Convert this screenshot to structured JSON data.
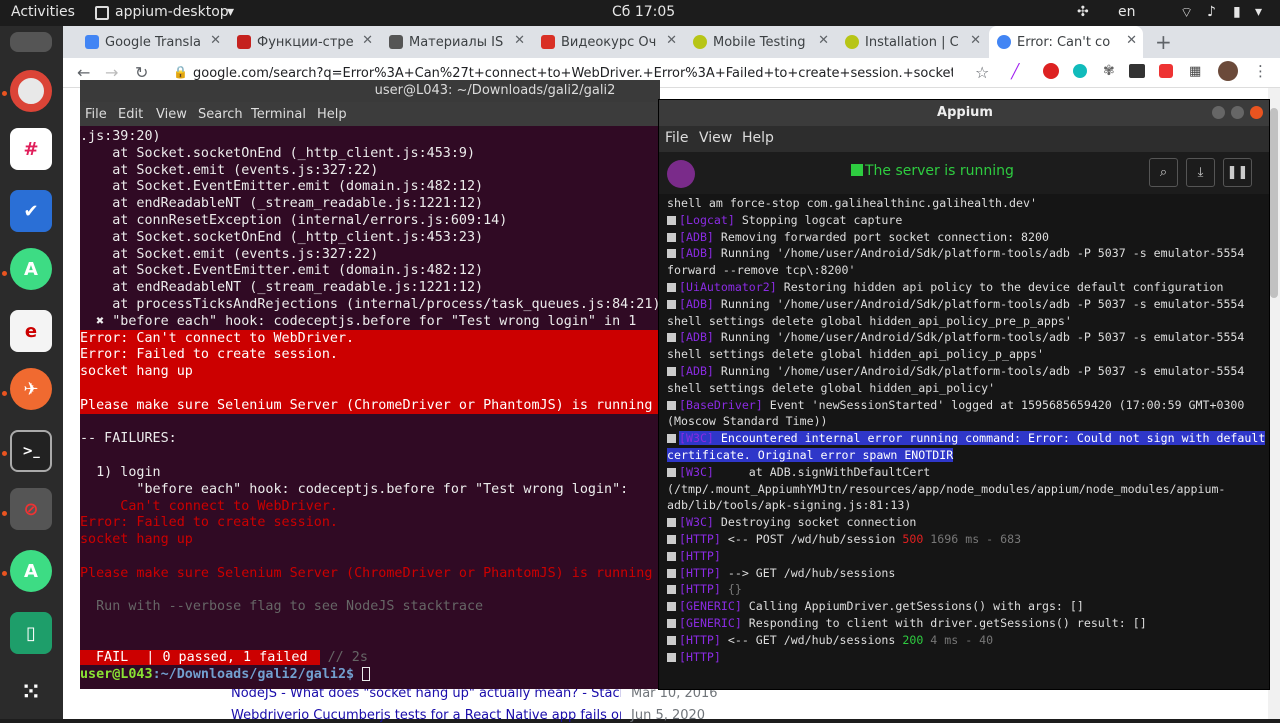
{
  "topbar": {
    "activities": "Activities",
    "app_name": "appium-desktop",
    "clock": "Сб 17:05",
    "lang": "en"
  },
  "browser": {
    "tabs": [
      {
        "title": "Google Transla",
        "color": "#4285f4"
      },
      {
        "title": "Функции-стре",
        "color": "#c5221f"
      },
      {
        "title": "Материалы IS",
        "color": "#555555"
      },
      {
        "title": "Видеокурс Оч",
        "color": "#d93025"
      },
      {
        "title": "Mobile Testing",
        "color": "#b7c516"
      },
      {
        "title": "Installation | C",
        "color": "#b7c516"
      },
      {
        "title": "Error: Can't co",
        "color": "#4285f4"
      }
    ],
    "url": "google.com/search?q=Error%3A+Can%27t+connect+to+WebDriver.+Error%3A+Failed+to+create+session.+socket+hang+up&o...",
    "results": [
      {
        "title": "NodeJS - What does \"socket hang up\" actually mean? - Stack ...",
        "date": "Mar 10, 2016"
      },
      {
        "title": "Webdriverio Cucumberjs tests for a React Native app fails on ...",
        "date": "Jun 5, 2020"
      }
    ]
  },
  "terminal": {
    "title": "user@L043: ~/Downloads/gali2/gali2",
    "menu": [
      "File",
      "Edit",
      "View",
      "Search",
      "Terminal",
      "Help"
    ],
    "lines": [
      {
        "t": ".js:39:20)",
        "c": ""
      },
      {
        "t": "    at Socket.socketOnEnd (_http_client.js:453:9)",
        "c": ""
      },
      {
        "t": "    at Socket.emit (events.js:327:22)",
        "c": ""
      },
      {
        "t": "    at Socket.EventEmitter.emit (domain.js:482:12)",
        "c": ""
      },
      {
        "t": "    at endReadableNT (_stream_readable.js:1221:12)",
        "c": ""
      },
      {
        "t": "    at connResetException (internal/errors.js:609:14)",
        "c": ""
      },
      {
        "t": "    at Socket.socketOnEnd (_http_client.js:453:23)",
        "c": ""
      },
      {
        "t": "    at Socket.emit (events.js:327:22)",
        "c": ""
      },
      {
        "t": "    at Socket.EventEmitter.emit (domain.js:482:12)",
        "c": ""
      },
      {
        "t": "    at endReadableNT (_stream_readable.js:1221:12)",
        "c": ""
      },
      {
        "t": "    at processTicksAndRejections (internal/process/task_queues.js:84:21)",
        "c": ""
      },
      {
        "t": "  ✖ \"before each\" hook: codeceptjs.before for \"Test wrong login\" in 1",
        "c": ""
      },
      {
        "t": "Error: Can't connect to WebDriver.",
        "c": "redbg"
      },
      {
        "t": "Error: Failed to create session.",
        "c": "redbg"
      },
      {
        "t": "socket hang up",
        "c": "redbg"
      },
      {
        "t": "",
        "c": "redbg"
      },
      {
        "t": "Please make sure Selenium Server (ChromeDriver or PhantomJS) is running",
        "c": "redbg"
      },
      {
        "t": "",
        "c": ""
      },
      {
        "t": "-- FAILURES:",
        "c": ""
      },
      {
        "t": "",
        "c": ""
      },
      {
        "t": "  1) login",
        "c": ""
      },
      {
        "t": "       \"before each\" hook: codeceptjs.before for \"Test wrong login\":",
        "c": ""
      },
      {
        "t": "     Can't connect to WebDriver.",
        "c": "red"
      },
      {
        "t": "Error: Failed to create session.",
        "c": "red"
      },
      {
        "t": "socket hang up",
        "c": "red"
      },
      {
        "t": "",
        "c": ""
      },
      {
        "t": "Please make sure Selenium Server (ChromeDriver or PhantomJS) is running",
        "c": "red"
      },
      {
        "t": "",
        "c": ""
      },
      {
        "t": "  Run with --verbose flag to see NodeJS stacktrace",
        "c": "dim"
      },
      {
        "t": "",
        "c": ""
      },
      {
        "t": "",
        "c": ""
      }
    ],
    "fail_label": "FAIL",
    "summary": "0 passed, 1 failed",
    "duration": "// 2s",
    "prompt_user": "user@L043",
    "prompt_path": ":~/Downloads/gali2/gali2$"
  },
  "appium": {
    "title": "Appium",
    "menu": [
      "File",
      "View",
      "Help"
    ],
    "status": "The server is running",
    "log": [
      {
        "tag": "",
        "text": "shell am force-stop com.galihealthinc.galihealth.dev'",
        "cont": true
      },
      {
        "tag": "[Logcat]",
        "text": " Stopping logcat capture"
      },
      {
        "tag": "[ADB]",
        "text": " Removing forwarded port socket connection: 8200"
      },
      {
        "tag": "[ADB]",
        "text": " Running '/home/user/Android/Sdk/platform-tools/adb -P 5037 -s emulator-5554"
      },
      {
        "tag": "",
        "text": "forward --remove tcp\\:8200'",
        "cont": true
      },
      {
        "tag": "[UiAutomator2]",
        "text": " Restoring hidden api policy to the device default configuration"
      },
      {
        "tag": "[ADB]",
        "text": " Running '/home/user/Android/Sdk/platform-tools/adb -P 5037 -s emulator-5554"
      },
      {
        "tag": "",
        "text": "shell settings delete global hidden_api_policy_pre_p_apps'",
        "cont": true
      },
      {
        "tag": "[ADB]",
        "text": " Running '/home/user/Android/Sdk/platform-tools/adb -P 5037 -s emulator-5554"
      },
      {
        "tag": "",
        "text": "shell settings delete global hidden_api_policy_p_apps'",
        "cont": true
      },
      {
        "tag": "[ADB]",
        "text": " Running '/home/user/Android/Sdk/platform-tools/adb -P 5037 -s emulator-5554"
      },
      {
        "tag": "",
        "text": "shell settings delete global hidden_api_policy'",
        "cont": true
      },
      {
        "tag": "[BaseDriver]",
        "text": " Event 'newSessionStarted' logged at 1595685659420 (17:00:59 GMT+0300"
      },
      {
        "tag": "",
        "text": "(Moscow Standard Time))",
        "cont": true
      },
      {
        "tag": "[W3C]",
        "text": " Encountered internal error running command: Error: Could not sign with default",
        "hl": true
      },
      {
        "tag": "",
        "text": "certificate. Original error spawn ENOTDIR",
        "cont": true,
        "hl": true
      },
      {
        "tag": "[W3C]",
        "text": "     at ADB.signWithDefaultCert"
      },
      {
        "tag": "",
        "text": "(/tmp/.mount_AppiumhYMJtn/resources/app/node_modules/appium/node_modules/appium-",
        "cont": true
      },
      {
        "tag": "",
        "text": "adb/lib/tools/apk-signing.js:81:13)",
        "cont": true
      },
      {
        "tag": "[W3C]",
        "text": " Destroying socket connection"
      },
      {
        "tag": "[HTTP]",
        "text": " <-- POST /wd/hub/session ",
        "code": "500",
        "codecls": "redt",
        "tail": " 1696 ms - 683"
      },
      {
        "tag": "[HTTP]",
        "text": ""
      },
      {
        "tag": "[HTTP]",
        "text": " --> GET /wd/hub/sessions"
      },
      {
        "tag": "[HTTP]",
        "text": " {}",
        "dimtext": true
      },
      {
        "tag": "[GENERIC]",
        "text": " Calling AppiumDriver.getSessions() with args: []"
      },
      {
        "tag": "[GENERIC]",
        "text": " Responding to client with driver.getSessions() result: []"
      },
      {
        "tag": "[HTTP]",
        "text": " <-- GET /wd/hub/sessions ",
        "code": "200",
        "codecls": "green",
        "tail": " 4 ms - 40"
      },
      {
        "tag": "[HTTP]",
        "text": ""
      }
    ]
  },
  "colors": {
    "terminal_bg": "#300a24",
    "error_red": "#cc0000",
    "highlight": "#2f37c9",
    "appium_tag": "#8a2be2"
  }
}
